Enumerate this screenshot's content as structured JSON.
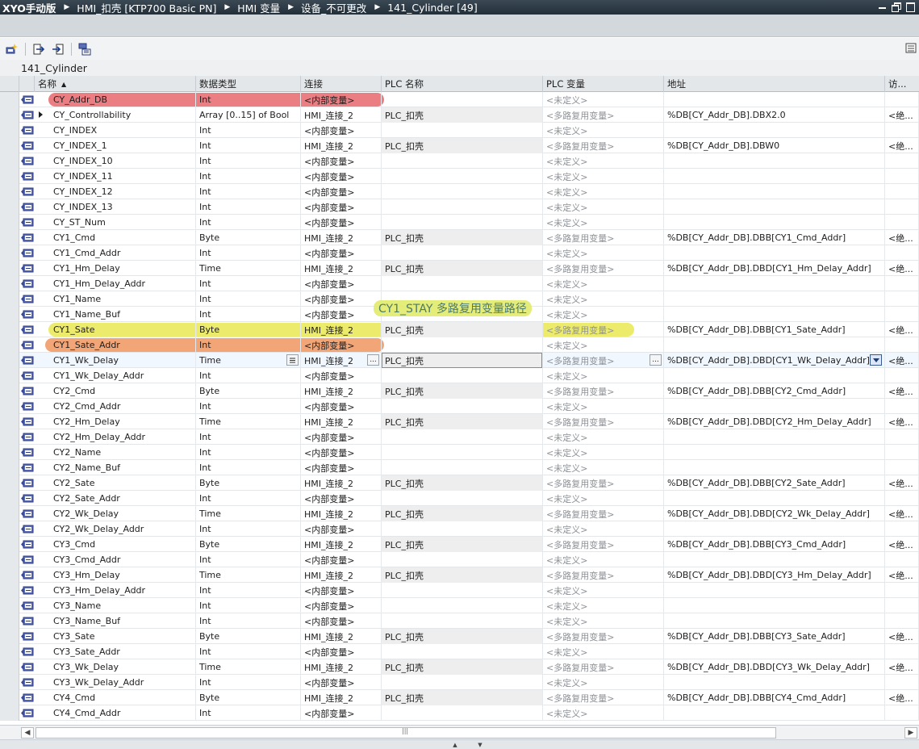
{
  "breadcrumb": [
    "XYO手动版",
    "HMI_扣壳 [KTP700 Basic PN]",
    "HMI 变量",
    "设备_不可更改",
    "141_Cylinder [49]"
  ],
  "table_name": "141_Cylinder",
  "columns": {
    "name": "名称",
    "datatype": "数据类型",
    "connection": "连接",
    "plc_name": "PLC 名称",
    "plc_tag": "PLC 变量",
    "address": "地址",
    "access": "访..."
  },
  "icons": {
    "row_tag": "hmi-tag-icon",
    "toolbar": [
      "add-tag-icon",
      "export-icon",
      "import-icon",
      "multiplex-icon"
    ]
  },
  "annotation": "CY1_STAY 多路复用变量路径",
  "highlight_colors": {
    "red": "#e65a5f",
    "yellow": "#e8e646",
    "orange": "#f0965f"
  },
  "rows": [
    {
      "name": "CY_Addr_DB",
      "type": "Int",
      "conn": "<内部变量>",
      "plc": "",
      "tag": "<未定义>",
      "addr": "",
      "access": ""
    },
    {
      "name": "CY_Controllability",
      "type": "Array [0..15] of Bool",
      "conn": "HMI_连接_2",
      "plc": "PLC_扣壳",
      "tag": "<多路复用变量>",
      "addr": "%DB[CY_Addr_DB].DBX2.0",
      "access": "<绝..."
    },
    {
      "name": "CY_INDEX",
      "type": "Int",
      "conn": "<内部变量>",
      "plc": "",
      "tag": "<未定义>",
      "addr": "",
      "access": ""
    },
    {
      "name": "CY_INDEX_1",
      "type": "Int",
      "conn": "HMI_连接_2",
      "plc": "PLC_扣壳",
      "tag": "<多路复用变量>",
      "addr": "%DB[CY_Addr_DB].DBW0",
      "access": "<绝..."
    },
    {
      "name": "CY_INDEX_10",
      "type": "Int",
      "conn": "<内部变量>",
      "plc": "",
      "tag": "<未定义>",
      "addr": "",
      "access": ""
    },
    {
      "name": "CY_INDEX_11",
      "type": "Int",
      "conn": "<内部变量>",
      "plc": "",
      "tag": "<未定义>",
      "addr": "",
      "access": ""
    },
    {
      "name": "CY_INDEX_12",
      "type": "Int",
      "conn": "<内部变量>",
      "plc": "",
      "tag": "<未定义>",
      "addr": "",
      "access": ""
    },
    {
      "name": "CY_INDEX_13",
      "type": "Int",
      "conn": "<内部变量>",
      "plc": "",
      "tag": "<未定义>",
      "addr": "",
      "access": ""
    },
    {
      "name": "CY_ST_Num",
      "type": "Int",
      "conn": "<内部变量>",
      "plc": "",
      "tag": "<未定义>",
      "addr": "",
      "access": ""
    },
    {
      "name": "CY1_Cmd",
      "type": "Byte",
      "conn": "HMI_连接_2",
      "plc": "PLC_扣壳",
      "tag": "<多路复用变量>",
      "addr": "%DB[CY_Addr_DB].DBB[CY1_Cmd_Addr]",
      "access": "<绝..."
    },
    {
      "name": "CY1_Cmd_Addr",
      "type": "Int",
      "conn": "<内部变量>",
      "plc": "",
      "tag": "<未定义>",
      "addr": "",
      "access": ""
    },
    {
      "name": "CY1_Hm_Delay",
      "type": "Time",
      "conn": "HMI_连接_2",
      "plc": "PLC_扣壳",
      "tag": "<多路复用变量>",
      "addr": "%DB[CY_Addr_DB].DBD[CY1_Hm_Delay_Addr]",
      "access": "<绝..."
    },
    {
      "name": "CY1_Hm_Delay_Addr",
      "type": "Int",
      "conn": "<内部变量>",
      "plc": "",
      "tag": "<未定义>",
      "addr": "",
      "access": ""
    },
    {
      "name": "CY1_Name",
      "type": "Int",
      "conn": "<内部变量>",
      "plc": "",
      "tag": "<未定义>",
      "addr": "",
      "access": ""
    },
    {
      "name": "CY1_Name_Buf",
      "type": "Int",
      "conn": "<内部变量>",
      "plc": "",
      "tag": "<未定义>",
      "addr": "",
      "access": ""
    },
    {
      "name": "CY1_Sate",
      "type": "Byte",
      "conn": "HMI_连接_2",
      "plc": "PLC_扣壳",
      "tag": "<多路复用变量>",
      "addr": "%DB[CY_Addr_DB].DBB[CY1_Sate_Addr]",
      "access": "<绝..."
    },
    {
      "name": "CY1_Sate_Addr",
      "type": "Int",
      "conn": "<内部变量>",
      "plc": "",
      "tag": "<未定义>",
      "addr": "",
      "access": ""
    },
    {
      "name": "CY1_Wk_Delay",
      "type": "Time",
      "conn": "HMI_连接_2",
      "plc": "PLC_扣壳",
      "tag": "<多路复用变量>",
      "addr": "%DB[CY_Addr_DB].DBD[CY1_Wk_Delay_Addr]",
      "access": "<绝..."
    },
    {
      "name": "CY1_Wk_Delay_Addr",
      "type": "Int",
      "conn": "<内部变量>",
      "plc": "",
      "tag": "<未定义>",
      "addr": "",
      "access": ""
    },
    {
      "name": "CY2_Cmd",
      "type": "Byte",
      "conn": "HMI_连接_2",
      "plc": "PLC_扣壳",
      "tag": "<多路复用变量>",
      "addr": "%DB[CY_Addr_DB].DBB[CY2_Cmd_Addr]",
      "access": "<绝..."
    },
    {
      "name": "CY2_Cmd_Addr",
      "type": "Int",
      "conn": "<内部变量>",
      "plc": "",
      "tag": "<未定义>",
      "addr": "",
      "access": ""
    },
    {
      "name": "CY2_Hm_Delay",
      "type": "Time",
      "conn": "HMI_连接_2",
      "plc": "PLC_扣壳",
      "tag": "<多路复用变量>",
      "addr": "%DB[CY_Addr_DB].DBD[CY2_Hm_Delay_Addr]",
      "access": "<绝..."
    },
    {
      "name": "CY2_Hm_Delay_Addr",
      "type": "Int",
      "conn": "<内部变量>",
      "plc": "",
      "tag": "<未定义>",
      "addr": "",
      "access": ""
    },
    {
      "name": "CY2_Name",
      "type": "Int",
      "conn": "<内部变量>",
      "plc": "",
      "tag": "<未定义>",
      "addr": "",
      "access": ""
    },
    {
      "name": "CY2_Name_Buf",
      "type": "Int",
      "conn": "<内部变量>",
      "plc": "",
      "tag": "<未定义>",
      "addr": "",
      "access": ""
    },
    {
      "name": "CY2_Sate",
      "type": "Byte",
      "conn": "HMI_连接_2",
      "plc": "PLC_扣壳",
      "tag": "<多路复用变量>",
      "addr": "%DB[CY_Addr_DB].DBB[CY2_Sate_Addr]",
      "access": "<绝..."
    },
    {
      "name": "CY2_Sate_Addr",
      "type": "Int",
      "conn": "<内部变量>",
      "plc": "",
      "tag": "<未定义>",
      "addr": "",
      "access": ""
    },
    {
      "name": "CY2_Wk_Delay",
      "type": "Time",
      "conn": "HMI_连接_2",
      "plc": "PLC_扣壳",
      "tag": "<多路复用变量>",
      "addr": "%DB[CY_Addr_DB].DBD[CY2_Wk_Delay_Addr]",
      "access": "<绝..."
    },
    {
      "name": "CY2_Wk_Delay_Addr",
      "type": "Int",
      "conn": "<内部变量>",
      "plc": "",
      "tag": "<未定义>",
      "addr": "",
      "access": ""
    },
    {
      "name": "CY3_Cmd",
      "type": "Byte",
      "conn": "HMI_连接_2",
      "plc": "PLC_扣壳",
      "tag": "<多路复用变量>",
      "addr": "%DB[CY_Addr_DB].DBB[CY3_Cmd_Addr]",
      "access": "<绝..."
    },
    {
      "name": "CY3_Cmd_Addr",
      "type": "Int",
      "conn": "<内部变量>",
      "plc": "",
      "tag": "<未定义>",
      "addr": "",
      "access": ""
    },
    {
      "name": "CY3_Hm_Delay",
      "type": "Time",
      "conn": "HMI_连接_2",
      "plc": "PLC_扣壳",
      "tag": "<多路复用变量>",
      "addr": "%DB[CY_Addr_DB].DBD[CY3_Hm_Delay_Addr]",
      "access": "<绝..."
    },
    {
      "name": "CY3_Hm_Delay_Addr",
      "type": "Int",
      "conn": "<内部变量>",
      "plc": "",
      "tag": "<未定义>",
      "addr": "",
      "access": ""
    },
    {
      "name": "CY3_Name",
      "type": "Int",
      "conn": "<内部变量>",
      "plc": "",
      "tag": "<未定义>",
      "addr": "",
      "access": ""
    },
    {
      "name": "CY3_Name_Buf",
      "type": "Int",
      "conn": "<内部变量>",
      "plc": "",
      "tag": "<未定义>",
      "addr": "",
      "access": ""
    },
    {
      "name": "CY3_Sate",
      "type": "Byte",
      "conn": "HMI_连接_2",
      "plc": "PLC_扣壳",
      "tag": "<多路复用变量>",
      "addr": "%DB[CY_Addr_DB].DBB[CY3_Sate_Addr]",
      "access": "<绝..."
    },
    {
      "name": "CY3_Sate_Addr",
      "type": "Int",
      "conn": "<内部变量>",
      "plc": "",
      "tag": "<未定义>",
      "addr": "",
      "access": ""
    },
    {
      "name": "CY3_Wk_Delay",
      "type": "Time",
      "conn": "HMI_连接_2",
      "plc": "PLC_扣壳",
      "tag": "<多路复用变量>",
      "addr": "%DB[CY_Addr_DB].DBD[CY3_Wk_Delay_Addr]",
      "access": "<绝..."
    },
    {
      "name": "CY3_Wk_Delay_Addr",
      "type": "Int",
      "conn": "<内部变量>",
      "plc": "",
      "tag": "<未定义>",
      "addr": "",
      "access": ""
    },
    {
      "name": "CY4_Cmd",
      "type": "Byte",
      "conn": "HMI_连接_2",
      "plc": "PLC_扣壳",
      "tag": "<多路复用变量>",
      "addr": "%DB[CY_Addr_DB].DBB[CY4_Cmd_Addr]",
      "access": "<绝..."
    },
    {
      "name": "CY4_Cmd_Addr",
      "type": "Int",
      "conn": "<内部变量>",
      "plc": "",
      "tag": "<未定义>",
      "addr": "",
      "access": ""
    }
  ]
}
